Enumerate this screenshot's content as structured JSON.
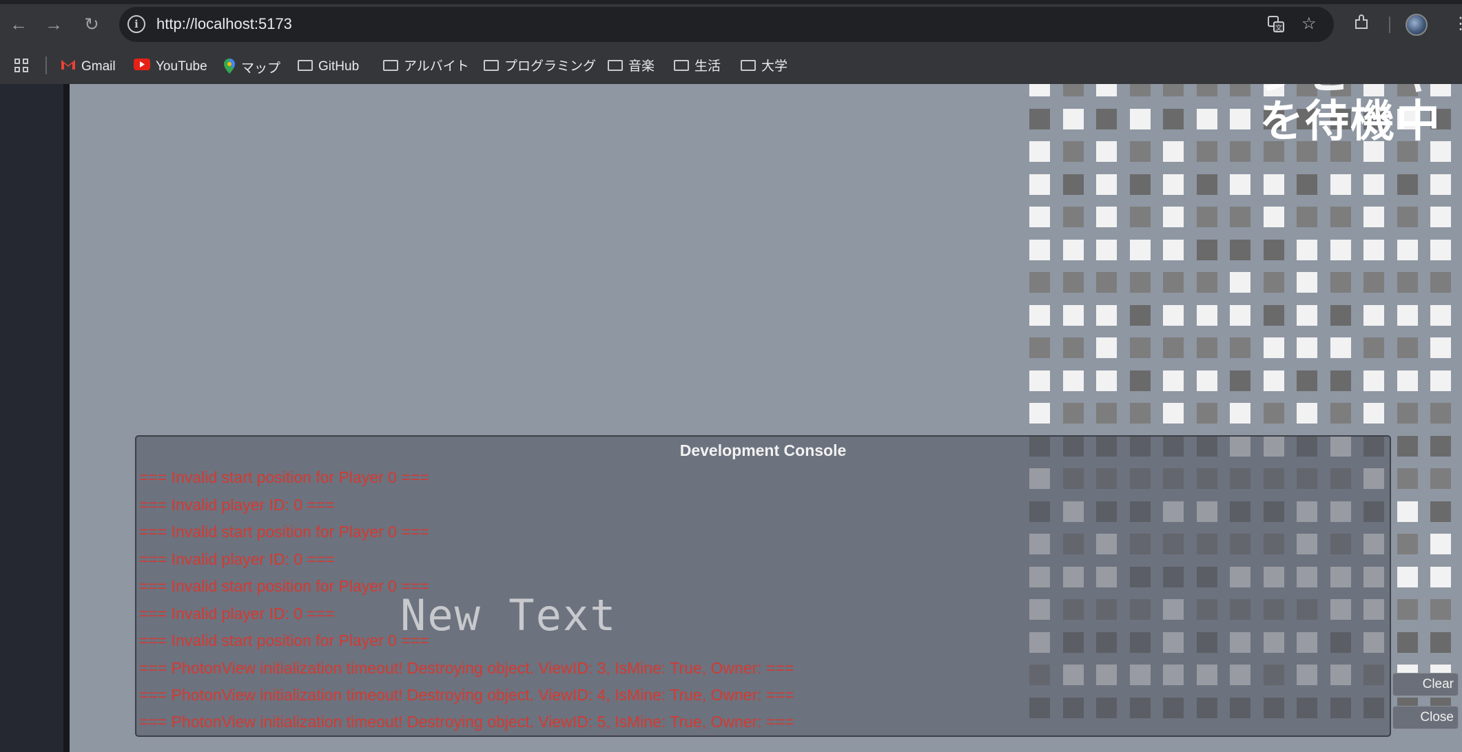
{
  "browser": {
    "url": "http://localhost:5173",
    "bookmarks": [
      {
        "label": "Gmail",
        "icon": "gmail-icon"
      },
      {
        "label": "YouTube",
        "icon": "youtube-icon"
      },
      {
        "label": "マップ",
        "icon": "maps-icon"
      },
      {
        "label": "GitHub",
        "icon": "folder-icon"
      },
      {
        "label": "アルバイト",
        "icon": "folder-icon"
      },
      {
        "label": "プログラミング",
        "icon": "folder-icon"
      },
      {
        "label": "音楽",
        "icon": "folder-icon"
      },
      {
        "label": "生活",
        "icon": "folder-icon"
      },
      {
        "label": "大学",
        "icon": "folder-icon"
      }
    ]
  },
  "game": {
    "waiting_text_top": "ンヒーヤ",
    "waiting_text": "を待機中",
    "overlay_text": "New Text",
    "grid_colors": {
      "bright": "#f2f2f2",
      "mid": "#7d7d7d",
      "dim": "#6a6a6a"
    }
  },
  "console": {
    "title": "Development Console",
    "logs": [
      "=== Invalid start position for Player 0 ===",
      "=== Invalid player ID: 0 ===",
      "=== Invalid start position for Player 0 ===",
      "=== Invalid player ID: 0 ===",
      "=== Invalid start position for Player 0 ===",
      "=== Invalid player ID: 0 ===",
      "=== Invalid start position for Player 0 ===",
      "=== PhotonView initialization timeout! Destroying object. ViewID: 3, IsMine: True, Owner:  ===",
      "=== PhotonView initialization timeout! Destroying object. ViewID: 4, IsMine: True, Owner:  ===",
      "=== PhotonView initialization timeout! Destroying object. ViewID: 5, IsMine: True, Owner:  ==="
    ],
    "log_color": "#d43a32",
    "clear_label": "Clear",
    "close_label": "Close"
  }
}
